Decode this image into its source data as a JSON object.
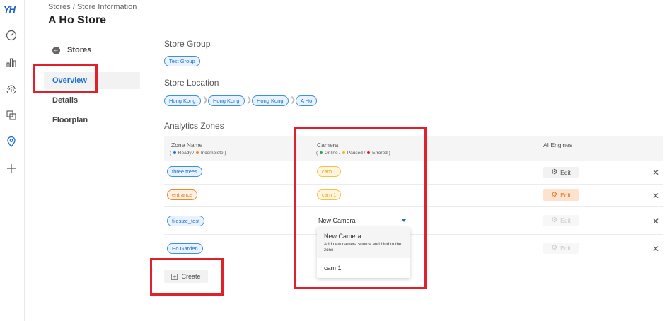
{
  "app": {
    "logo": "YH"
  },
  "rail_icons": [
    "gauge-icon",
    "bar-chart-icon",
    "fingerprint-icon",
    "layers-icon",
    "location-pin-icon",
    "plus-icon"
  ],
  "breadcrumb": "Stores / Store Information",
  "page_title": "A Ho Store",
  "sidebar": {
    "back_label": "Stores",
    "items": [
      {
        "label": "Overview",
        "active": true
      },
      {
        "label": "Details",
        "active": false
      },
      {
        "label": "Floorplan",
        "active": false
      }
    ]
  },
  "store_group": {
    "label": "Store Group",
    "tags": [
      "Test Group"
    ]
  },
  "store_location": {
    "label": "Store Location",
    "path": [
      "Hong Kong",
      "Hong Kong",
      "Hong Kong",
      "A Ho"
    ]
  },
  "analytics": {
    "label": "Analytics Zones",
    "columns": {
      "zone": {
        "title": "Zone Name",
        "open": "(",
        "legend1": "Ready /",
        "legend2": "Incomplete )"
      },
      "camera": {
        "title": "Camera",
        "open": "(",
        "legend1": "Online /",
        "legend2": "Paused /",
        "legend3": "Errored )"
      },
      "engines": {
        "title": "AI Engines"
      }
    },
    "rows": [
      {
        "zone": "three trees",
        "zone_status": "ready",
        "camera": "cam 1",
        "edit": "Edit",
        "edit_state": "normal"
      },
      {
        "zone": "entrance",
        "zone_status": "incomplete",
        "camera": "cam 1",
        "edit": "Edit",
        "edit_state": "warning"
      },
      {
        "zone": "filesize_test",
        "zone_status": "ready",
        "camera_select": "New Camera",
        "edit": "Edit",
        "edit_state": "disabled"
      },
      {
        "zone": "Ho Garden",
        "zone_status": "ready",
        "camera": "",
        "edit": "Edit",
        "edit_state": "disabled"
      }
    ],
    "dropdown": {
      "options": [
        {
          "title": "New Camera",
          "desc": "Add new camera source and bind to the zone"
        },
        {
          "title": "cam 1"
        }
      ]
    },
    "create_label": "Create"
  },
  "colors": {
    "accent": "#1a6fd8",
    "ready": "#1a6fd8",
    "incomplete": "#f0892a",
    "online": "#22aa55",
    "paused": "#f5b800",
    "errored": "#e0202a",
    "highlight": "#e0202a"
  }
}
